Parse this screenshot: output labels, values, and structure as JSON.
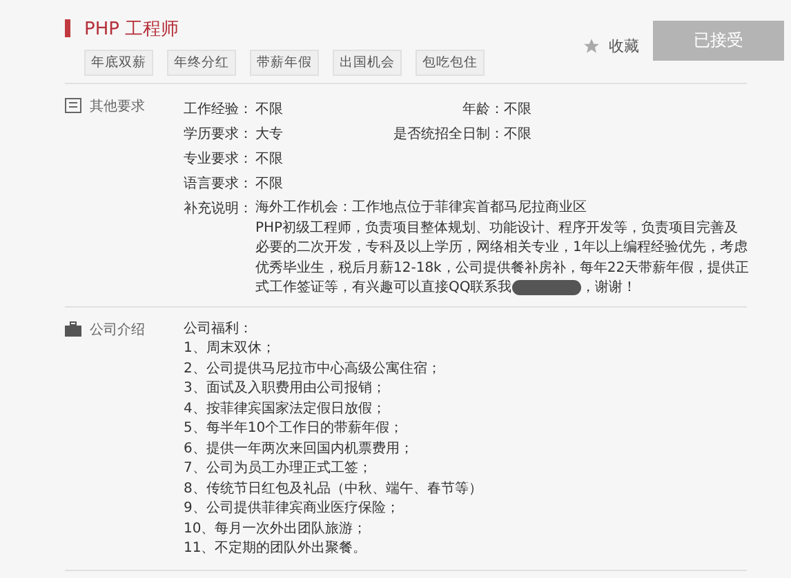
{
  "job": {
    "title": "PHP 工程师",
    "tags": [
      "年底双薪",
      "年终分红",
      "带薪年假",
      "出国机会",
      "包吃包住"
    ],
    "favorite": {
      "label": "收藏",
      "selected": false
    },
    "apply_button": {
      "label": "已接受",
      "disabled": true
    }
  },
  "requirements": {
    "heading": "其他要求",
    "fields": [
      {
        "label": "工作经验：",
        "value": "不限",
        "side_label": "年龄：",
        "side_value": "不限"
      },
      {
        "label": "学历要求：",
        "value": "大专",
        "side_label": "是否统招全日制：",
        "side_value": "不限"
      },
      {
        "label": "专业要求：",
        "value": "不限"
      },
      {
        "label": "语言要求：",
        "value": "不限"
      }
    ],
    "supplement": {
      "label": "补充说明：",
      "first_line": "海外工作机会：工作地点位于菲律宾首都马尼拉商业区",
      "body": "PHP初级工程师，负责项目整体规划、功能设计、程序开发等，负责项目完善及必要的二次开发，专科及以上学历，网络相关专业，1年以上编程经验优先，考虑优秀毕业生，税后月薪12-18k，公司提供餐补房补，每年22天带薪年假，提供正式工作签证等，有兴趣可以直接QQ联系我",
      "redacted": true,
      "ending": "，谢谢！"
    }
  },
  "company": {
    "heading": "公司介绍",
    "lines": [
      "公司福利：",
      "1、周末双休；",
      "2、公司提供马尼拉市中心高级公寓住宿；",
      "3、面试及入职费用由公司报销；",
      "4、按菲律宾国家法定假日放假；",
      "5、每半年10个工作日的带薪年假；",
      "6、提供一年两次来回国内机票费用；",
      "7、公司为员工办理正式工签；",
      "8、传统节日红包及礼品（中秋、端午、春节等）",
      "9、公司提供菲律宾商业医疗保险；",
      "10、每月一次外出团队旅游；",
      "11、不定期的团队外出聚餐。"
    ]
  }
}
